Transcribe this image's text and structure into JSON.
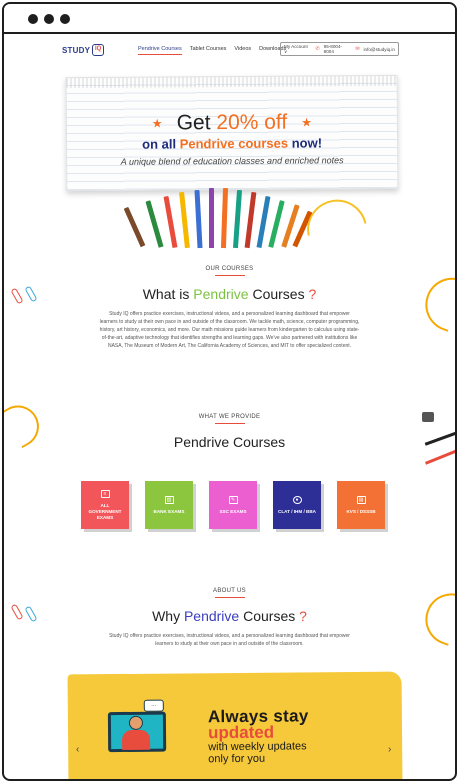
{
  "nav": {
    "logo_text": "STUDY",
    "logo_badge": "IQ",
    "links": [
      "Pendrive Courses",
      "Tablet Courses",
      "Videos",
      "Downloads"
    ],
    "account_label": "My Account",
    "account_chevron": "∨",
    "phone": "95-8004-8004",
    "email": "info@studyiq.in"
  },
  "hero": {
    "line1_prefix": "Get ",
    "line1_accent": "20% off",
    "line2_prefix": "on all ",
    "line2_accent": "Pendrive courses",
    "line2_suffix": " now!",
    "line3": "A unique blend of education classes and enriched notes"
  },
  "our_courses": {
    "eyebrow": "OUR COURSES",
    "title_prefix": "What is ",
    "title_accent": "Pendrive",
    "title_suffix": " Courses ",
    "title_q": "?",
    "body": "Study IQ offers practice exercises, instructional videos, and a personalized learning dashboard that empower learners to study at their own pace in and outside of the classroom. We tackle math, science, computer programming, history, art history, economics, and more. Our math missions guide learners from kindergarten to calculus using state-of-the-art, adaptive technology that identifies strengths and learning gaps. We've also partnered with institutions like NASA, The Museum of Modern Art, The California Academy of Sciences, and MIT to offer specialized content."
  },
  "what_we_provide": {
    "eyebrow": "WHAT WE PROVIDE",
    "title": "Pendrive Courses",
    "cards": [
      {
        "label": "ALL GOVERNMENT EXAMS",
        "color": "#f2555a",
        "icon": "id-card-icon"
      },
      {
        "label": "BANK EXAMS",
        "color": "#8cc63f",
        "icon": "bank-icon"
      },
      {
        "label": "SSC EXAMS",
        "color": "#ec5fd0",
        "icon": "edit-icon"
      },
      {
        "label": "CLAT / IHM / BBA",
        "color": "#2d2f97",
        "icon": "user-icon"
      },
      {
        "label": "KVS / DSSSB",
        "color": "#f37135",
        "icon": "document-icon"
      }
    ]
  },
  "about_us": {
    "eyebrow": "ABOUT US",
    "title_prefix": "Why ",
    "title_accent": "Pendrive",
    "title_suffix": " Courses ",
    "title_q": "?",
    "body": "Study IQ offers practice exercises, instructional videos, and a personalized learning dashboard that empower learners to study at their own pace in and outside of the classroom."
  },
  "banner": {
    "line1": "Always stay",
    "line2": "updated",
    "line3": "with weekly updates",
    "line4": "only for you",
    "bubble": "...",
    "prev": "‹",
    "next": "›"
  },
  "colors": {
    "accent_orange": "#f36f21",
    "accent_red": "#e84c3d",
    "accent_green": "#7cc242",
    "brand_blue": "#2b3a8c",
    "banner_yellow": "#f6c93a"
  }
}
